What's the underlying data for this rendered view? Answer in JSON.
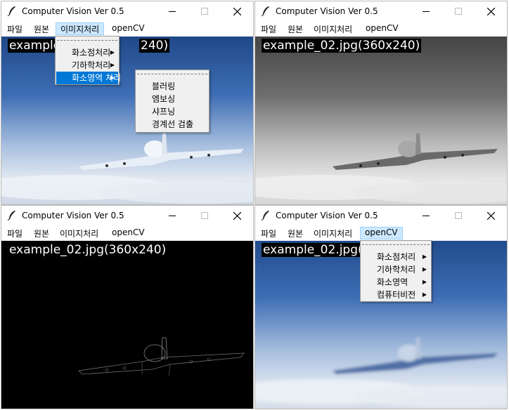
{
  "window_title": "Computer Vision Ver 0.5",
  "menu": [
    "파일",
    "원본",
    "이미지처리",
    "openCV"
  ],
  "image_label": "example_02.jpg(360x240)",
  "windows": {
    "tl": {
      "image_label_visible": "example",
      "image_label_tail": "240)",
      "active_menu": "이미지처리"
    },
    "tr": {
      "filter": "grayscale"
    },
    "bl": {
      "filter": "edge"
    },
    "br": {
      "active_menu": "openCV",
      "image_label_visible": "example_02.jpg(",
      "filter": "blur"
    }
  },
  "image_proc_menu": {
    "items": [
      "화소점처리",
      "기하학처리",
      "화소영역 처리"
    ],
    "highlighted": "화소영역 처리"
  },
  "area_submenu": {
    "items": [
      "블러링",
      "엠보싱",
      "샤프닝",
      "경계선 검출"
    ]
  },
  "opencv_menu": {
    "items": [
      "화소점처리",
      "기하학처리",
      "화소영역",
      "컴퓨터비전"
    ]
  },
  "colors": {
    "menu_active_bg": "#cce8ff",
    "menu_highlight": "#0078d7",
    "sky_top": "#2a4f8f",
    "cloud": "#dde4ee"
  },
  "icons": [
    "feather-icon",
    "minimize-icon",
    "maximize-icon",
    "close-icon",
    "submenu-arrow-icon"
  ]
}
